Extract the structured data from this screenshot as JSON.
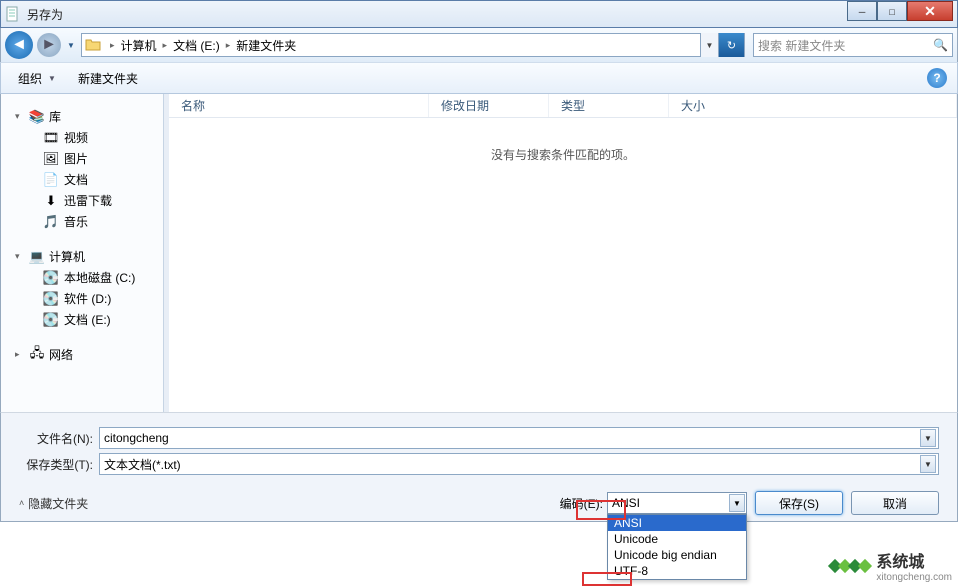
{
  "window": {
    "title": "另存为"
  },
  "nav": {
    "breadcrumbs": [
      "计算机",
      "文档 (E:)",
      "新建文件夹"
    ],
    "search_placeholder": "搜索 新建文件夹"
  },
  "toolbar": {
    "organize": "组织",
    "new_folder": "新建文件夹"
  },
  "tree": {
    "libraries": {
      "label": "库",
      "children": [
        "视频",
        "图片",
        "文档",
        "迅雷下载",
        "音乐"
      ]
    },
    "computer": {
      "label": "计算机",
      "children": [
        "本地磁盘 (C:)",
        "软件 (D:)",
        "文档 (E:)"
      ]
    },
    "network": {
      "label": "网络"
    }
  },
  "list": {
    "columns": [
      "名称",
      "修改日期",
      "类型",
      "大小"
    ],
    "empty_message": "没有与搜索条件匹配的项。"
  },
  "form": {
    "filename_label": "文件名(N):",
    "filename_value": "citongcheng",
    "filetype_label": "保存类型(T):",
    "filetype_value": "文本文档(*.txt)",
    "encoding_label": "编码(E):",
    "encoding_value": "ANSI",
    "encoding_options": [
      "ANSI",
      "Unicode",
      "Unicode big endian",
      "UTF-8"
    ],
    "hide_folders": "隐藏文件夹",
    "save": "保存(S)",
    "cancel": "取消"
  },
  "watermark": {
    "brand": "系统城",
    "domain": "xitongcheng.com"
  }
}
